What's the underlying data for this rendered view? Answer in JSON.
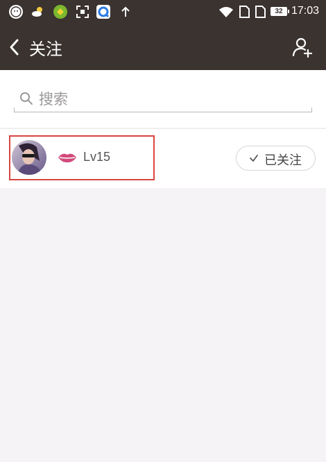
{
  "status_bar": {
    "time": "17:03",
    "battery": "32",
    "icons": [
      "baby-app-icon",
      "weather-icon",
      "green-app-icon",
      "scan-icon",
      "browser-icon",
      "upload-arrow-icon",
      "wifi-icon",
      "sim1-icon",
      "sim2-icon",
      "battery-icon"
    ]
  },
  "header": {
    "title": "关注",
    "back_icon": "chevron-left-icon",
    "action_icon": "add-user-icon"
  },
  "search": {
    "placeholder": "搜索",
    "value": ""
  },
  "following": [
    {
      "level": "Lv15",
      "badge_icon": "lips-icon",
      "button_label": "已关注",
      "button_icon": "check-icon"
    }
  ],
  "colors": {
    "header_bg": "#3a3330",
    "highlight": "#d9443f",
    "lips": "#d24b7c"
  }
}
